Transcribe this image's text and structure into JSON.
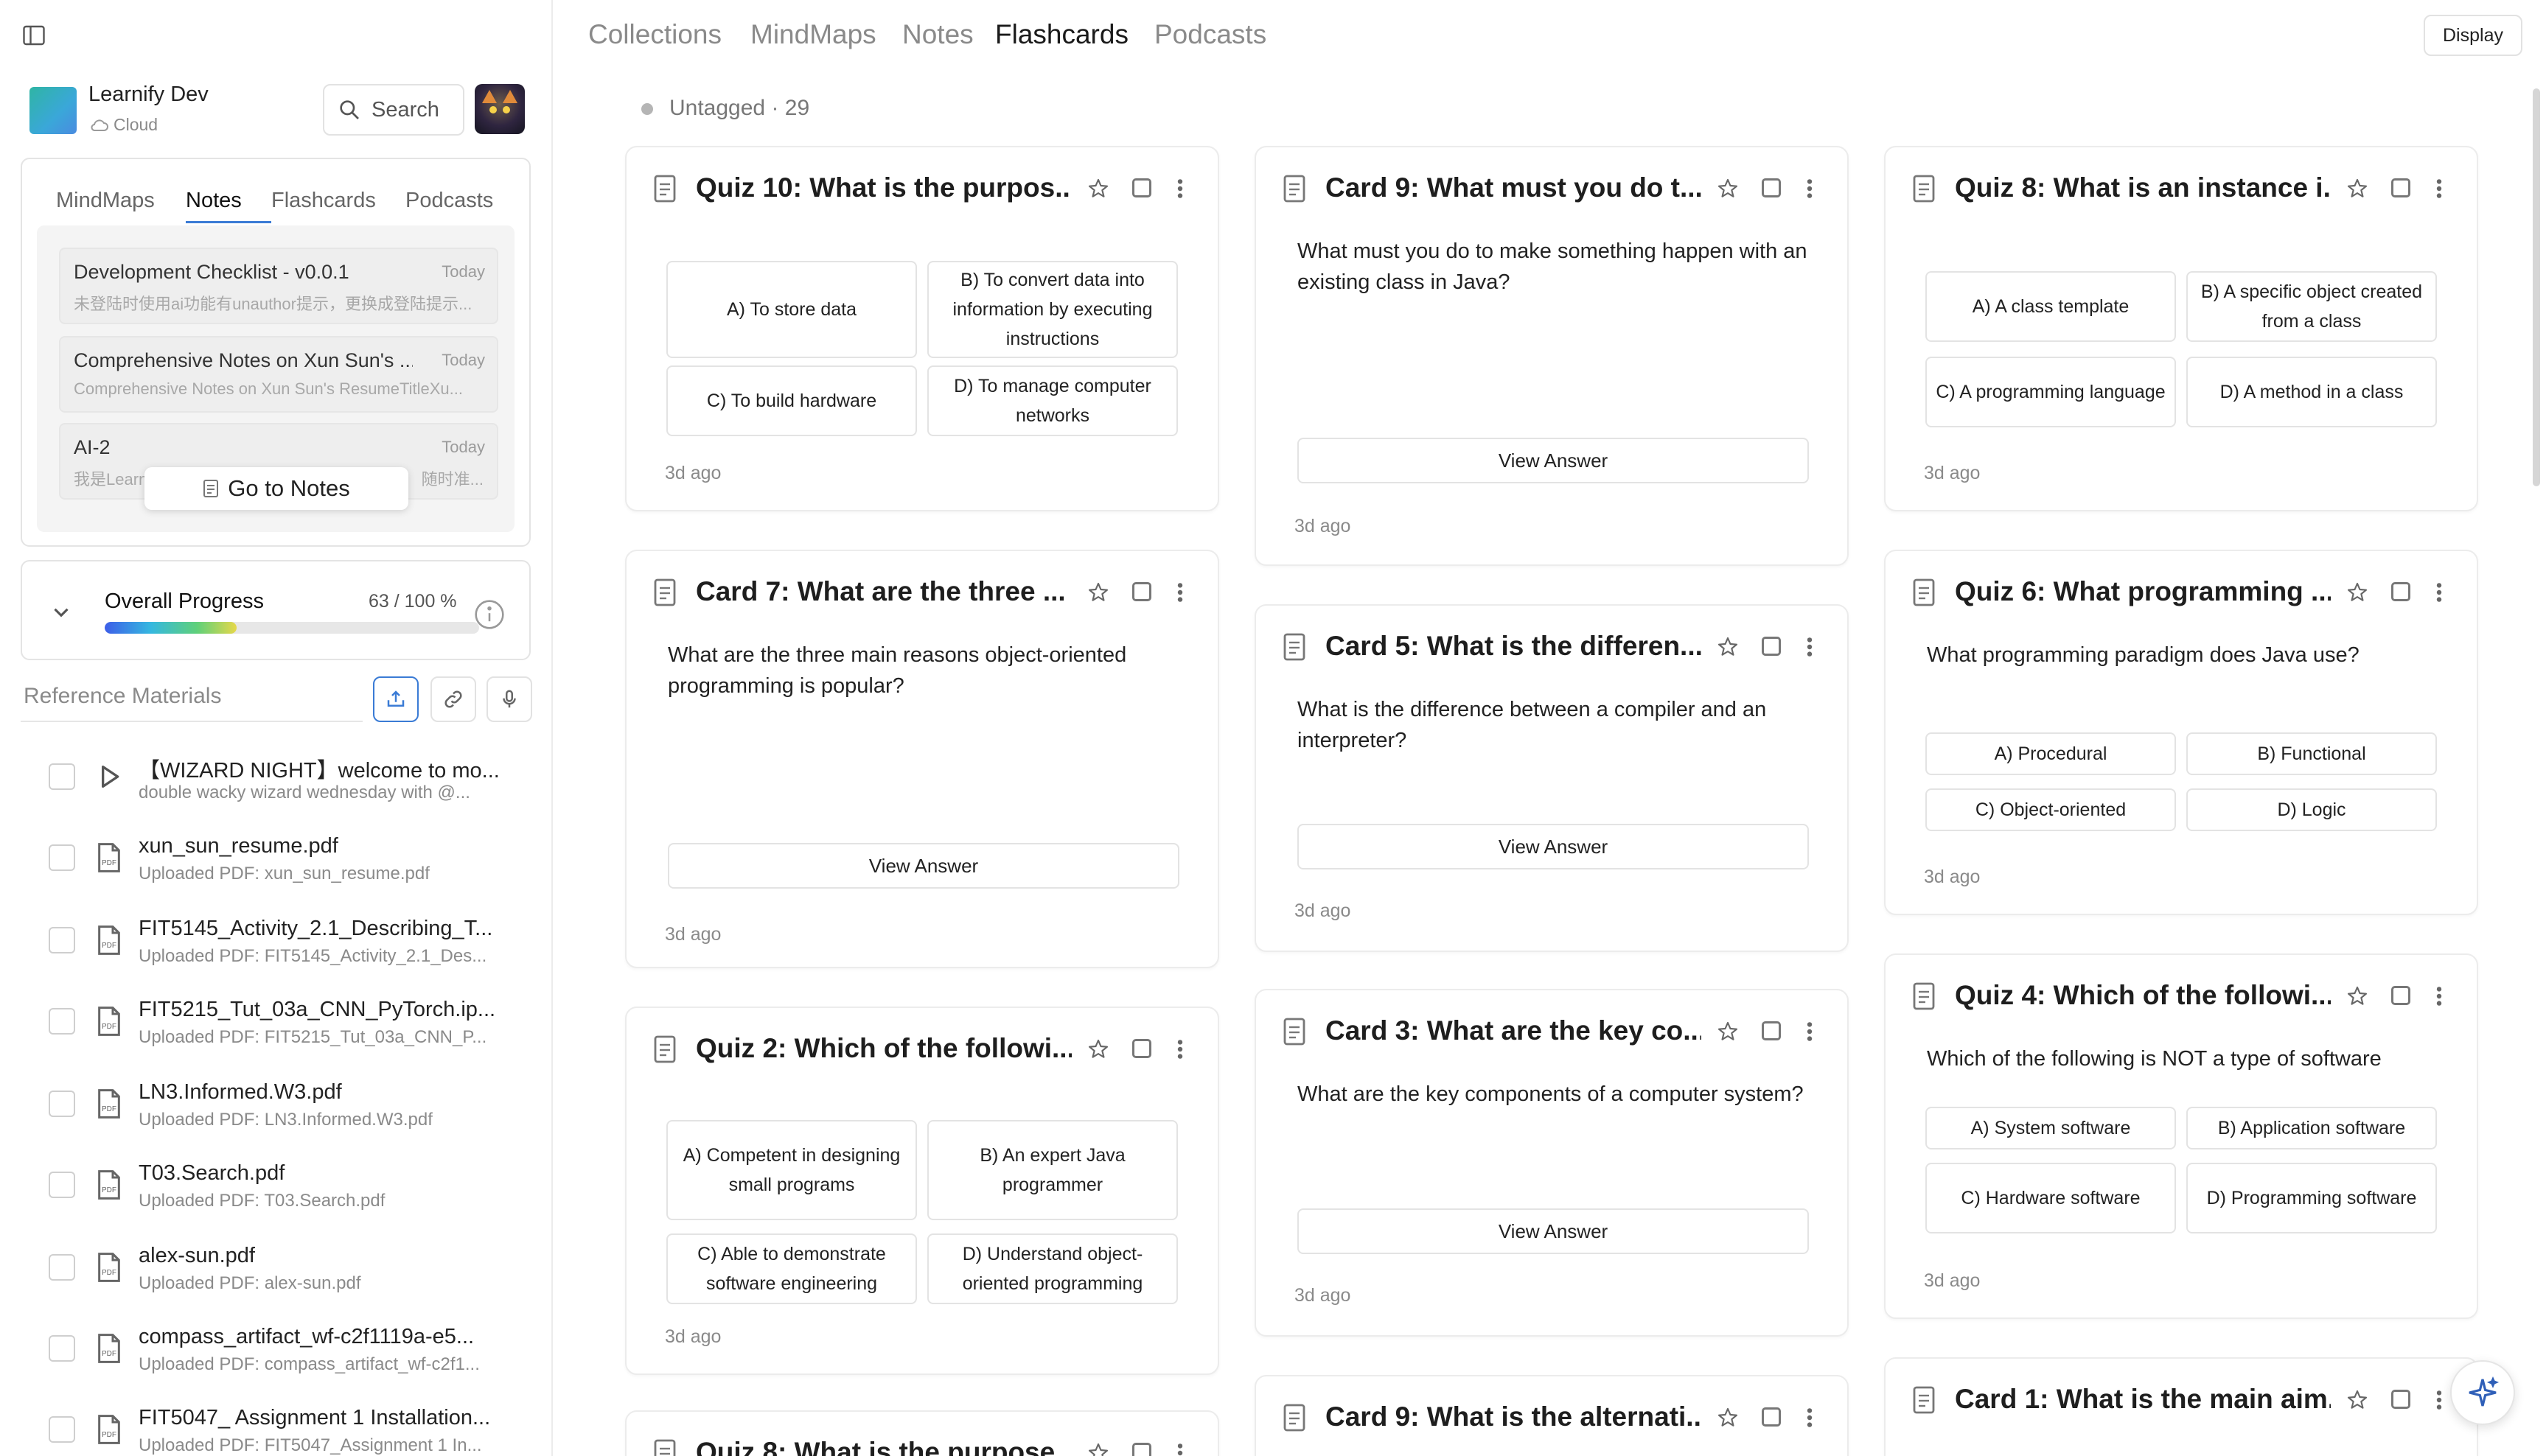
{
  "sidebar": {
    "app": {
      "name": "Learnify Dev",
      "subtitle": "Cloud"
    },
    "search_label": "Search",
    "tabs": [
      "MindMaps",
      "Notes",
      "Flashcards",
      "Podcasts"
    ],
    "active_tab": "Notes",
    "notes": [
      {
        "title": "Development Checklist - v0.0.1",
        "date": "Today",
        "preview": "未登陆时使用ai功能有unauthor提示，更换成登陆提示..."
      },
      {
        "title": "Comprehensive Notes on Xun Sun's ...",
        "date": "Today",
        "preview": "Comprehensive Notes on Xun Sun's ResumeTitleXu..."
      },
      {
        "title": "AI-2",
        "date": "Today",
        "preview_left": "我是Learn",
        "preview_right": "随时准..."
      }
    ],
    "go_to_notes": "Go to Notes",
    "progress": {
      "label": "Overall Progress",
      "count": "63 / 100 %",
      "fraction": 0.63
    },
    "reference_title": "Reference Materials",
    "references": [
      {
        "name": "【WIZARD NIGHT】welcome to mo...",
        "sub": "double wacky wizard wednesday with @...",
        "icon": "play-icon"
      },
      {
        "name": "xun_sun_resume.pdf",
        "sub": "Uploaded PDF: xun_sun_resume.pdf",
        "icon": "pdf-icon"
      },
      {
        "name": "FIT5145_Activity_2.1_Describing_T...",
        "sub": "Uploaded PDF: FIT5145_Activity_2.1_Des...",
        "icon": "pdf-icon"
      },
      {
        "name": "FIT5215_Tut_03a_CNN_PyTorch.ip...",
        "sub": "Uploaded PDF: FIT5215_Tut_03a_CNN_P...",
        "icon": "pdf-icon"
      },
      {
        "name": "LN3.Informed.W3.pdf",
        "sub": "Uploaded PDF: LN3.Informed.W3.pdf",
        "icon": "pdf-icon"
      },
      {
        "name": "T03.Search.pdf",
        "sub": "Uploaded PDF: T03.Search.pdf",
        "icon": "pdf-icon"
      },
      {
        "name": "alex-sun.pdf",
        "sub": "Uploaded PDF: alex-sun.pdf",
        "icon": "pdf-icon"
      },
      {
        "name": "compass_artifact_wf-c2f1119a-e5...",
        "sub": "Uploaded PDF: compass_artifact_wf-c2f1...",
        "icon": "pdf-icon"
      },
      {
        "name": "FIT5047_ Assignment 1 Installation...",
        "sub": "Uploaded PDF: FIT5047_Assignment 1 In...",
        "icon": "pdf-icon"
      }
    ]
  },
  "nav": {
    "items": [
      "Collections",
      "MindMaps",
      "Notes",
      "Flashcards",
      "Podcasts"
    ],
    "active": "Flashcards",
    "display_label": "Display"
  },
  "tag": {
    "label": "Untagged · 29"
  },
  "cards": {
    "c1_1": {
      "title": "Quiz 10: What is the purpos...",
      "time": "3d ago",
      "options": [
        "A) To store data",
        "B) To convert data into information by executing instructions",
        "C) To build hardware",
        "D) To manage computer networks"
      ]
    },
    "c1_2": {
      "title": "Card 7: What are the three ...",
      "question": "What are the three main reasons object-oriented programming is popular?",
      "view": "View Answer",
      "time": "3d ago"
    },
    "c1_3": {
      "title": "Quiz 2: Which of the followi...",
      "time": "3d ago",
      "options": [
        "A) Competent in designing small programs",
        "B) An expert Java programmer",
        "C) Able to demonstrate software engineering",
        "D) Understand object-oriented programming"
      ]
    },
    "c1_4": {
      "title": "Quiz 8: What is the purpose..."
    },
    "c2_1": {
      "title": "Card 9: What must you do t...",
      "question": "What must you do to make something happen with an existing class in Java?",
      "view": "View Answer",
      "time": "3d ago"
    },
    "c2_2": {
      "title": "Card 5: What is the differen...",
      "question": "What is the difference between a compiler and an interpreter?",
      "view": "View Answer",
      "time": "3d ago"
    },
    "c2_3": {
      "title": "Card 3: What are the key co...",
      "question": "What are the key components of a computer system?",
      "view": "View Answer",
      "time": "3d ago"
    },
    "c2_4": {
      "title": "Card 9: What is the alternati..."
    },
    "c3_1": {
      "title": "Quiz 8: What is an instance i...",
      "time": "3d ago",
      "options": [
        "A) A class template",
        "B) A specific object created from a class",
        "C) A programming language",
        "D) A method in a class"
      ]
    },
    "c3_2": {
      "title": "Quiz 6: What programming ...",
      "question": "What programming paradigm does Java use?",
      "time": "3d ago",
      "options": [
        "A) Procedural",
        "B) Functional",
        "C) Object-oriented",
        "D) Logic"
      ]
    },
    "c3_3": {
      "title": "Quiz 4: Which of the followi...",
      "question": "Which of the following is NOT a type of software",
      "time": "3d ago",
      "options": [
        "A) System software",
        "B) Application software",
        "C) Hardware software",
        "D) Programming software"
      ]
    },
    "c3_4": {
      "title": "Card 1: What is the main aim..."
    }
  },
  "colors": {
    "accent": "#3a7bd5",
    "border": "#ececec",
    "muted": "#8a8a8a"
  }
}
